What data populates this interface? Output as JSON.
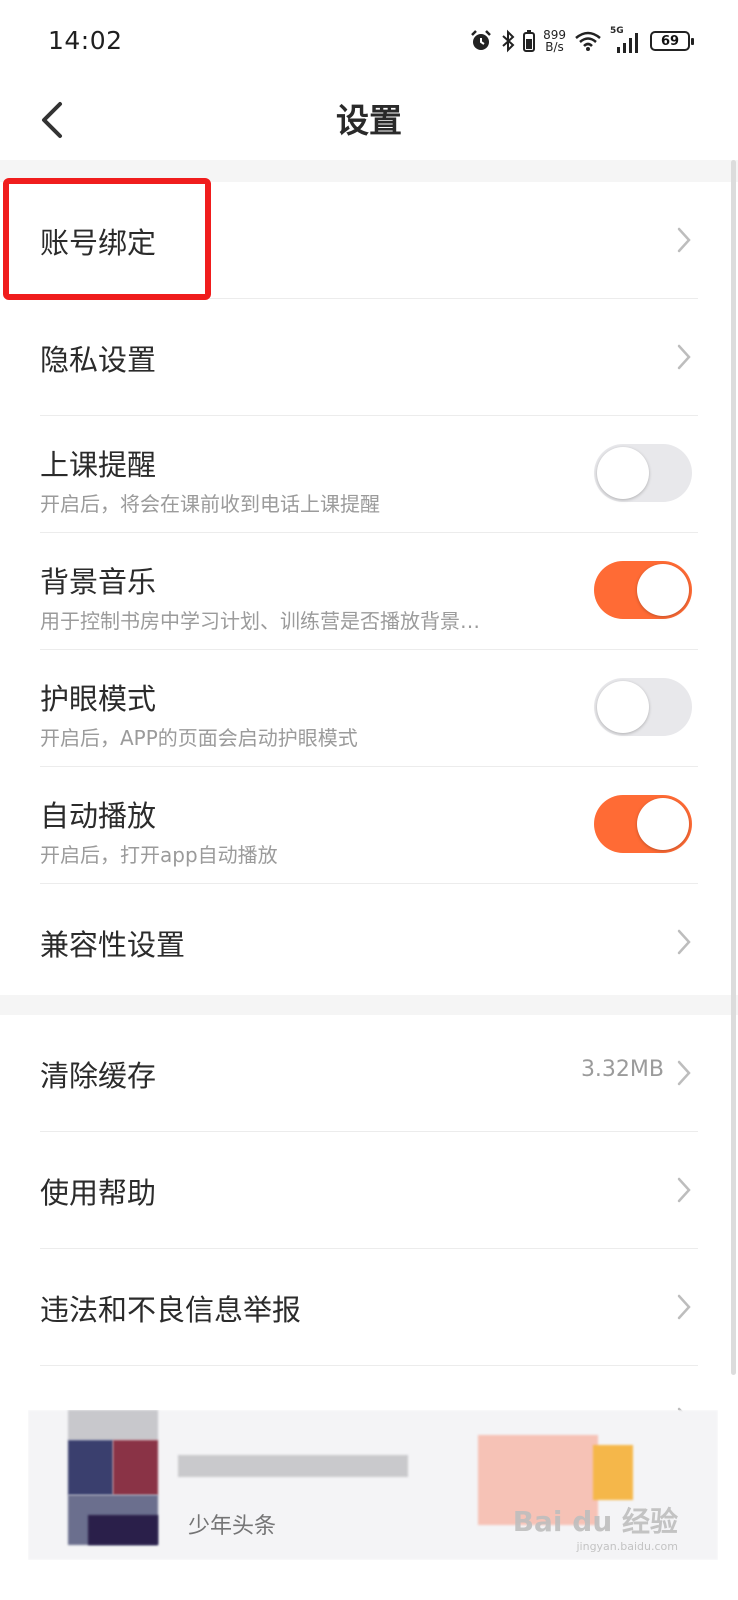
{
  "status_bar": {
    "time": "14:02",
    "net_speed_value": "899",
    "net_speed_unit": "B/s",
    "network": "5G",
    "battery": "69"
  },
  "header": {
    "title": "设置"
  },
  "section1": [
    {
      "title": "账号绑定",
      "type": "link"
    },
    {
      "title": "隐私设置",
      "type": "link"
    },
    {
      "title": "上课提醒",
      "subtitle": "开启后，将会在课前收到电话上课提醒",
      "type": "toggle",
      "on": false
    },
    {
      "title": "背景音乐",
      "subtitle": "用于控制书房中学习计划、训练营是否播放背景…",
      "type": "toggle",
      "on": true
    },
    {
      "title": "护眼模式",
      "subtitle": "开启后，APP的页面会启动护眼模式",
      "type": "toggle",
      "on": false
    },
    {
      "title": "自动播放",
      "subtitle": "开启后，打开app自动播放",
      "type": "toggle",
      "on": true
    },
    {
      "title": "兼容性设置",
      "type": "link"
    }
  ],
  "section2": [
    {
      "title": "清除缓存",
      "value": "3.32MB",
      "type": "link"
    },
    {
      "title": "使用帮助",
      "type": "link"
    },
    {
      "title": "违法和不良信息举报",
      "type": "link"
    }
  ],
  "ad": {
    "caption": "少年头条"
  },
  "watermark": {
    "text": "Bai du 经验",
    "sub": "jingyan.baidu.com"
  },
  "colors": {
    "accent": "#ff6b35",
    "highlight": "#f01d1d",
    "toggle_off": "#e8e8eb"
  }
}
